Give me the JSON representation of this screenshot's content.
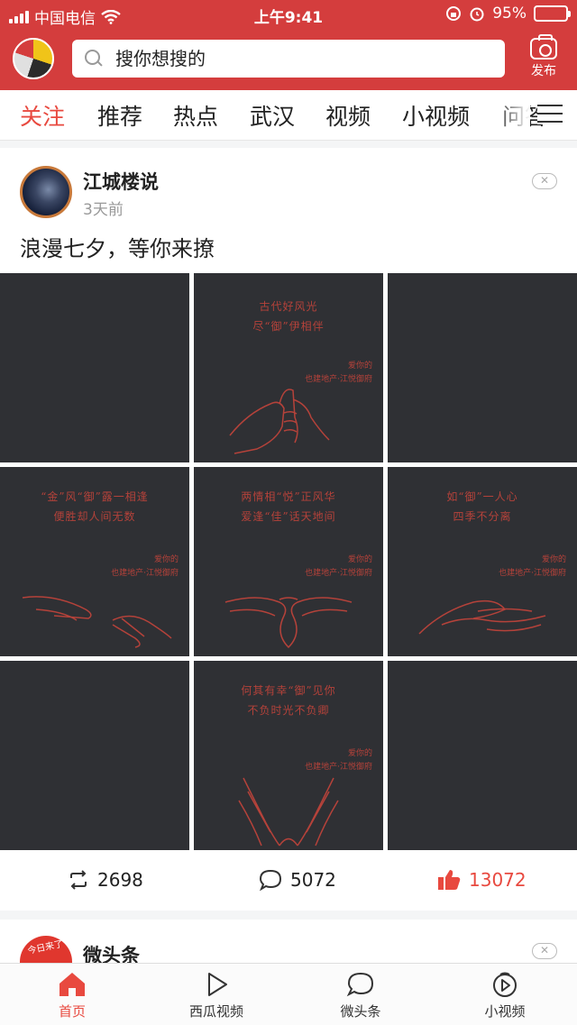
{
  "status_bar": {
    "carrier": "中国电信",
    "time": "上午9:41",
    "battery": "95%",
    "battery_level": 0.95
  },
  "header": {
    "search_placeholder": "搜你想搜的",
    "publish_label": "发布",
    "brand_color": "#d43d3d"
  },
  "tabs": [
    {
      "label": "关注",
      "active": true
    },
    {
      "label": "推荐"
    },
    {
      "label": "热点"
    },
    {
      "label": "武汉"
    },
    {
      "label": "视频"
    },
    {
      "label": "小视频"
    },
    {
      "label": "问答"
    }
  ],
  "post": {
    "author": "江城楼说",
    "time": "3天前",
    "text": "浪漫七夕，等你来撩",
    "dismiss_label": "✕",
    "images": [
      {
        "lines": [],
        "signature": []
      },
      {
        "lines": [
          "古代好风光",
          "尽“御”伊相伴"
        ],
        "signature": [
          "爱你的",
          "也建地产·江悦御府"
        ]
      },
      {
        "lines": [],
        "signature": []
      },
      {
        "lines": [
          "“金”风“御”露一相逢",
          "便胜却人间无数"
        ],
        "signature": [
          "爱你的",
          "也建地产·江悦御府"
        ]
      },
      {
        "lines": [
          "两情相“悦”正风华",
          "爱逢“佳”话天地间"
        ],
        "signature": [
          "爱你的",
          "也建地产·江悦御府"
        ]
      },
      {
        "lines": [
          "如“御”一人心",
          "四季不分离"
        ],
        "signature": [
          "爱你的",
          "也建地产·江悦御府"
        ]
      },
      {
        "lines": [],
        "signature": []
      },
      {
        "lines": [
          "何其有幸“御”见你",
          "不负时光不负卿"
        ],
        "signature": [
          "爱你的",
          "也建地产·江悦御府"
        ]
      },
      {
        "lines": [],
        "signature": []
      }
    ],
    "stats": {
      "repost": "2698",
      "comment": "5072",
      "like": "13072"
    }
  },
  "next_post": {
    "author": "微头条",
    "avatar_text": "今日来了",
    "dismiss_label": "✕"
  },
  "bottom_nav": [
    {
      "label": "首页",
      "icon": "home-icon",
      "active": true
    },
    {
      "label": "西瓜视频",
      "icon": "play-icon"
    },
    {
      "label": "微头条",
      "icon": "chat-icon"
    },
    {
      "label": "小视频",
      "icon": "small-video-icon"
    }
  ],
  "colors": {
    "accent": "#e8493f",
    "image_bg": "#2f3034",
    "line_art": "#b5423a"
  }
}
